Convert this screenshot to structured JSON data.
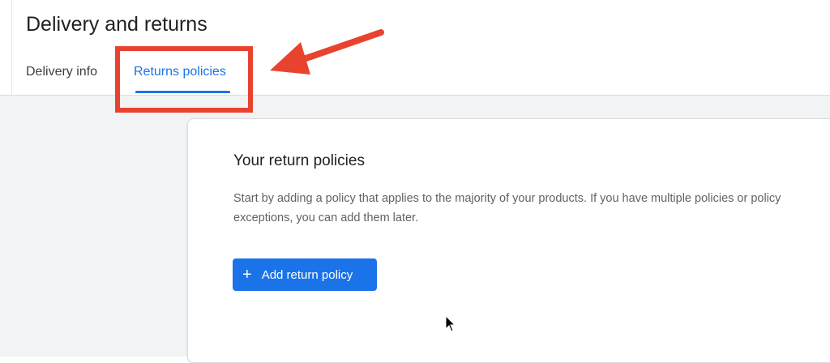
{
  "header": {
    "title": "Delivery and returns",
    "tabs": [
      {
        "label": "Delivery info",
        "active": false
      },
      {
        "label": "Returns policies",
        "active": true
      }
    ]
  },
  "card": {
    "title": "Your return policies",
    "description": "Start by adding a policy that applies to the majority of your products. If you have multiple policies or policy exceptions, you can add them later.",
    "button": {
      "icon": "plus-icon",
      "label": "Add return policy"
    }
  },
  "annotation": {
    "highlight_color": "#e8432f"
  },
  "colors": {
    "accent": "#1a73e8",
    "background": "#f1f3f4"
  }
}
